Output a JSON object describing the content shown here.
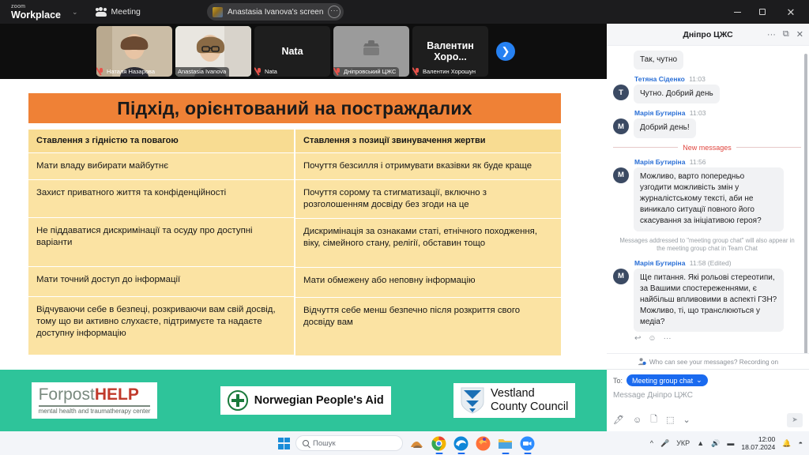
{
  "titlebar": {
    "brand_top": "zoom",
    "brand_main": "Workplace",
    "caret": "⌄",
    "meeting_label": "Meeting",
    "share_text": "Anastasia Ivanova's screen",
    "share_more": "···",
    "minimize": "–",
    "maximize": "❐",
    "close": "✕"
  },
  "filmstrip": {
    "next_arrow": "❯",
    "tiles": [
      {
        "name": "Наталя Назарова",
        "type": "video",
        "muted": true,
        "active": false,
        "boxed": false
      },
      {
        "name": "Anastasia Ivanova",
        "type": "video",
        "muted": false,
        "active": true,
        "boxed": true
      },
      {
        "name": "Nata",
        "display": "Nata",
        "type": "name",
        "muted": true,
        "active": false,
        "boxed": false
      },
      {
        "name": "Дніпровський ЦЖС",
        "type": "avatar",
        "muted": true,
        "active": false,
        "boxed": true
      },
      {
        "name": "Валентин Хорошун",
        "display": "Валентин  Хоро...",
        "type": "name",
        "muted": true,
        "active": false,
        "boxed": false
      }
    ]
  },
  "slide": {
    "title": "Підхід, орієнтований на постраждалих",
    "left_header": "Ставлення з гідністю та повагою",
    "right_header": "Ставлення з позиції звинувачення жертви",
    "left_rows": [
      "Мати владу вибирати майбутнє",
      "Захист приватного життя та конфіденційності",
      "Не піддаватися дискримінації та осуду про доступні варіанти",
      "Мати точний доступ до інформації",
      "Відчуваючи себе в безпеці, розкриваючи вам свій досвід, тому що ви активно слухаєте, підтримуєте та надаєте доступну інформацію"
    ],
    "right_rows": [
      "Почуття безсилля і отримувати вказівки як буде краще",
      "Почуття сорому та стигматизації, включно з розголошенням досвіду без згоди на це",
      "Дискримінація за ознаками статі, етнічного походження, віку, сімейного стану, релігії, обставин тощо",
      "Мати обмежену або неповну інформацію",
      "Відчуття себе менш безпечно після розкриття свого досвіду вам"
    ],
    "logos": {
      "forpost_1": "Forpost",
      "forpost_2": "HELP",
      "forpost_sub": "mental health and traumatherapy  center",
      "npa": "Norwegian People's Aid",
      "vestland_1": "Vestland",
      "vestland_2": "County Council"
    },
    "colors": {
      "title_bg": "#ef8136",
      "cell_bg": "#fbe3a3",
      "header_cell_bg": "#f8dc92",
      "footer_band": "#2ec49a"
    }
  },
  "chat": {
    "title": "Дніпро ЦЖС",
    "more": "···",
    "popout": "⧉",
    "close": "✕",
    "new_messages_label": "New messages",
    "notice": "Messages addressed to \"meeting group chat\" will also appear in the meeting group chat in Team Chat",
    "privacy": "Who can see your messages? Recording on",
    "messages": [
      {
        "author": "",
        "time": "",
        "avatar": "",
        "text": "Так, чутно",
        "show_meta": false
      },
      {
        "author": "Тетяна Сіденко",
        "time": "11:03",
        "avatar": "Т",
        "text": "Чутно. Добрий день",
        "show_meta": true
      },
      {
        "author": "Марія Бутиріна",
        "time": "11:03",
        "avatar": "М",
        "text": "Добрий день!",
        "show_meta": true
      },
      {
        "author": "Марія Бутиріна",
        "time": "11:56",
        "avatar": "М",
        "text": "Можливо, варто попередньо узгодити можливість змін у журналістському тексті, аби не виникало ситуації повного його скасування за ініціативою героя?",
        "show_meta": true
      },
      {
        "author": "Марія Бутиріна",
        "time": "11:58 (Edited)",
        "avatar": "М",
        "text": "Ще питання. Які рольові стереотипи, за Вашими спостереженнями, є найбільш впливовими в аспекті ГЗН? Можливо, ті, що транслюються у медіа?",
        "show_meta": true
      }
    ],
    "reactions": [
      "↩",
      "☺",
      "···"
    ],
    "compose": {
      "to_label": "To:",
      "to_value": "Meeting group chat",
      "to_caret": "⌄",
      "placeholder": "Message Дніпро ЦЖС",
      "tools": [
        "format-icon",
        "emoji-icon",
        "file-icon",
        "screenshot-icon",
        "chevron-down-icon"
      ],
      "send": "➤"
    }
  },
  "taskbar": {
    "search_placeholder": "Пошук",
    "language": "УКР",
    "time": "12:00",
    "date": "18.07.2024",
    "tray_caret": "^",
    "apps": [
      "weather",
      "chrome",
      "edge",
      "firefox",
      "explorer",
      "zoom"
    ]
  }
}
